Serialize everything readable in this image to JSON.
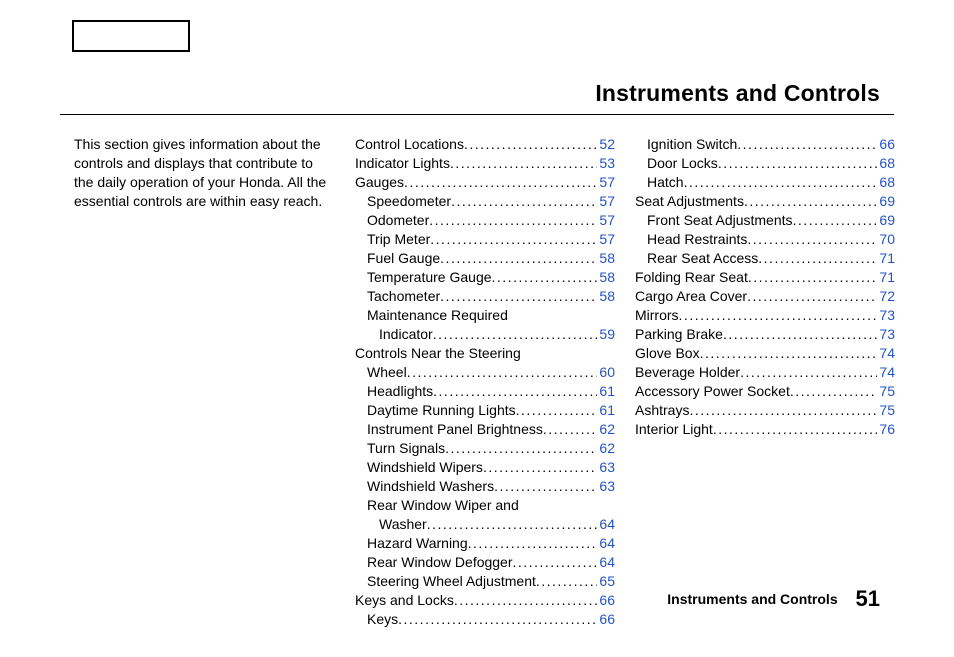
{
  "title": "Instruments and Controls",
  "intro": "This section gives information about the controls and displays that contribute to the daily operation of your Honda. All the essential controls are within easy reach.",
  "footer": {
    "section": "Instruments and Controls",
    "page": "51"
  },
  "col1": [
    {
      "label": "Control Locations",
      "page": "52",
      "indent": 0
    },
    {
      "label": "Indicator Lights",
      "page": "53",
      "indent": 0
    },
    {
      "label": "Gauges",
      "page": "57",
      "indent": 0
    },
    {
      "label": "Speedometer",
      "page": "57",
      "indent": 1
    },
    {
      "label": "Odometer",
      "page": "57",
      "indent": 1
    },
    {
      "label": "Trip Meter",
      "page": "57",
      "indent": 1
    },
    {
      "label": "Fuel Gauge",
      "page": "58",
      "indent": 1
    },
    {
      "label": "Temperature Gauge",
      "page": "58",
      "indent": 1
    },
    {
      "label": "Tachometer",
      "page": "58",
      "indent": 1
    },
    {
      "label": "Maintenance Required",
      "wrap2": "Indicator",
      "page": "59",
      "indent": 1
    },
    {
      "label": "Controls Near the Steering",
      "wrap2": "Wheel",
      "page": "60",
      "indent": 0
    },
    {
      "label": "Headlights",
      "page": "61",
      "indent": 1
    },
    {
      "label": "Daytime Running Lights",
      "page": "61",
      "indent": 1
    },
    {
      "label": "Instrument Panel Brightness",
      "page": "62",
      "indent": 1
    },
    {
      "label": "Turn Signals",
      "page": "62",
      "indent": 1
    },
    {
      "label": "Windshield Wipers",
      "page": "63",
      "indent": 1
    },
    {
      "label": "Windshield Washers",
      "page": "63",
      "indent": 1
    },
    {
      "label": "Rear Window Wiper and",
      "wrap2": "Washer",
      "page": "64",
      "indent": 1
    },
    {
      "label": "Hazard Warning",
      "page": "64",
      "indent": 1
    },
    {
      "label": "Rear Window Defogger",
      "page": "64",
      "indent": 1
    },
    {
      "label": "Steering Wheel Adjustment",
      "page": "65",
      "indent": 1
    },
    {
      "label": "Keys and Locks",
      "page": "66",
      "indent": 0
    },
    {
      "label": "Keys",
      "page": "66",
      "indent": 1
    }
  ],
  "col2": [
    {
      "label": "Ignition Switch",
      "page": "66",
      "indent": 1
    },
    {
      "label": "Door Locks",
      "page": "68",
      "indent": 1
    },
    {
      "label": "Hatch",
      "page": "68",
      "indent": 1
    },
    {
      "label": "Seat Adjustments",
      "page": "69",
      "indent": 0
    },
    {
      "label": "Front Seat Adjustments",
      "page": "69",
      "indent": 1
    },
    {
      "label": "Head Restraints",
      "page": "70",
      "indent": 1
    },
    {
      "label": "Rear Seat Access",
      "page": "71",
      "indent": 1
    },
    {
      "label": "Folding Rear Seat",
      "page": "71",
      "indent": 0
    },
    {
      "label": "Cargo Area Cover",
      "page": "72",
      "indent": 0
    },
    {
      "label": "Mirrors",
      "page": "73",
      "indent": 0
    },
    {
      "label": "Parking Brake",
      "page": "73",
      "indent": 0
    },
    {
      "label": "Glove Box",
      "page": "74",
      "indent": 0
    },
    {
      "label": "Beverage Holder",
      "page": "74",
      "indent": 0
    },
    {
      "label": "Accessory Power Socket",
      "page": "75",
      "indent": 0
    },
    {
      "label": "Ashtrays",
      "page": "75",
      "indent": 0
    },
    {
      "label": "Interior Light",
      "page": "76",
      "indent": 0
    }
  ]
}
